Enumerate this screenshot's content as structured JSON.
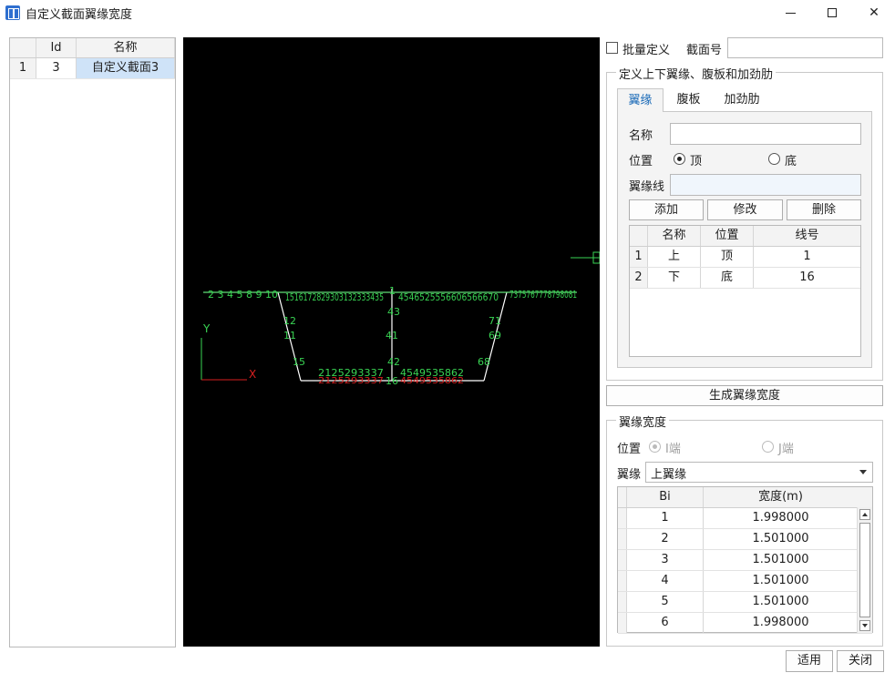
{
  "window": {
    "title": "自定义截面翼缘宽度"
  },
  "section_list": {
    "headers": [
      "",
      "Id",
      "名称"
    ],
    "rows": [
      {
        "index": "1",
        "id": "3",
        "name": "自定义截面3"
      }
    ]
  },
  "canvas": {
    "axis_y": "Y",
    "axis_x": "X",
    "node_labels_top": "2 3 4  5  8  9 10",
    "node_labels_top_mid": "1516172829303132333435",
    "node_labels_top_mid2": "4546525556606566670",
    "node_labels_top_right": "7375767778798081",
    "node_labels_bottom": "2125293337",
    "node_labels_bottom2": "4549535862",
    "web_labels": {
      "n1": "1",
      "n12": "12",
      "n11": "11",
      "n15": "15",
      "n43": "43",
      "n41": "41",
      "n42": "42",
      "n16": "16",
      "n71": "71",
      "n69": "69",
      "n68": "68",
      "n5": "5",
      "n8": "8",
      "n9": "9"
    }
  },
  "batch": {
    "checkbox_label": "批量定义",
    "section_no_label": "截面号",
    "section_no_value": ""
  },
  "define_group": {
    "title": "定义上下翼缘、腹板和加劲肋",
    "tabs": [
      "翼缘",
      "腹板",
      "加劲肋"
    ],
    "name_label": "名称",
    "name_value": "",
    "position_label": "位置",
    "pos_top": "顶",
    "pos_bottom": "底",
    "flange_line_label": "翼缘线",
    "flange_line_value": "",
    "add_button": "添加",
    "modify_button": "修改",
    "delete_button": "删除",
    "table_headers": [
      "",
      "名称",
      "位置",
      "线号"
    ],
    "table_rows": [
      {
        "index": "1",
        "name": "上",
        "position": "顶",
        "line": "1"
      },
      {
        "index": "2",
        "name": "下",
        "position": "底",
        "line": "16"
      }
    ]
  },
  "generate_button": "生成翼缘宽度",
  "width_group": {
    "title": "翼缘宽度",
    "position_label": "位置",
    "end_i": "I端",
    "end_j": "J端",
    "flange_label": "翼缘",
    "flange_select": "上翼缘",
    "table_headers": [
      "",
      "Bi",
      "宽度(m)"
    ],
    "table_rows": [
      {
        "bi": "1",
        "width": "1.998000"
      },
      {
        "bi": "2",
        "width": "1.501000"
      },
      {
        "bi": "3",
        "width": "1.501000"
      },
      {
        "bi": "4",
        "width": "1.501000"
      },
      {
        "bi": "5",
        "width": "1.501000"
      },
      {
        "bi": "6",
        "width": "1.998000"
      }
    ]
  },
  "footer": {
    "apply_button": "适用",
    "close_button": "关闭"
  },
  "colors": {
    "accent": "#1c6bb8",
    "canvas_bg": "#000000",
    "node_green": "#39d353",
    "node_red": "#d92020",
    "section_white": "#ffffff"
  }
}
